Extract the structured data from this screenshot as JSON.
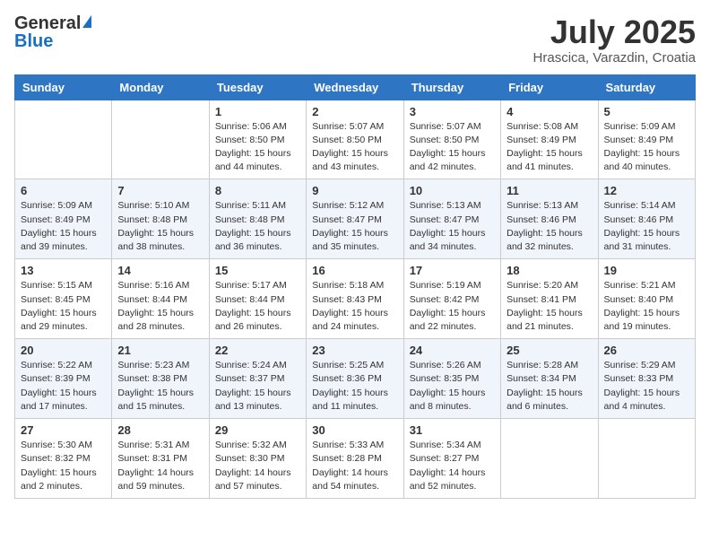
{
  "header": {
    "logo_general": "General",
    "logo_blue": "Blue",
    "month_year": "July 2025",
    "location": "Hrascica, Varazdin, Croatia"
  },
  "days_of_week": [
    "Sunday",
    "Monday",
    "Tuesday",
    "Wednesday",
    "Thursday",
    "Friday",
    "Saturday"
  ],
  "weeks": [
    [
      {
        "day": "",
        "info": ""
      },
      {
        "day": "",
        "info": ""
      },
      {
        "day": "1",
        "info": "Sunrise: 5:06 AM\nSunset: 8:50 PM\nDaylight: 15 hours\nand 44 minutes."
      },
      {
        "day": "2",
        "info": "Sunrise: 5:07 AM\nSunset: 8:50 PM\nDaylight: 15 hours\nand 43 minutes."
      },
      {
        "day": "3",
        "info": "Sunrise: 5:07 AM\nSunset: 8:50 PM\nDaylight: 15 hours\nand 42 minutes."
      },
      {
        "day": "4",
        "info": "Sunrise: 5:08 AM\nSunset: 8:49 PM\nDaylight: 15 hours\nand 41 minutes."
      },
      {
        "day": "5",
        "info": "Sunrise: 5:09 AM\nSunset: 8:49 PM\nDaylight: 15 hours\nand 40 minutes."
      }
    ],
    [
      {
        "day": "6",
        "info": "Sunrise: 5:09 AM\nSunset: 8:49 PM\nDaylight: 15 hours\nand 39 minutes."
      },
      {
        "day": "7",
        "info": "Sunrise: 5:10 AM\nSunset: 8:48 PM\nDaylight: 15 hours\nand 38 minutes."
      },
      {
        "day": "8",
        "info": "Sunrise: 5:11 AM\nSunset: 8:48 PM\nDaylight: 15 hours\nand 36 minutes."
      },
      {
        "day": "9",
        "info": "Sunrise: 5:12 AM\nSunset: 8:47 PM\nDaylight: 15 hours\nand 35 minutes."
      },
      {
        "day": "10",
        "info": "Sunrise: 5:13 AM\nSunset: 8:47 PM\nDaylight: 15 hours\nand 34 minutes."
      },
      {
        "day": "11",
        "info": "Sunrise: 5:13 AM\nSunset: 8:46 PM\nDaylight: 15 hours\nand 32 minutes."
      },
      {
        "day": "12",
        "info": "Sunrise: 5:14 AM\nSunset: 8:46 PM\nDaylight: 15 hours\nand 31 minutes."
      }
    ],
    [
      {
        "day": "13",
        "info": "Sunrise: 5:15 AM\nSunset: 8:45 PM\nDaylight: 15 hours\nand 29 minutes."
      },
      {
        "day": "14",
        "info": "Sunrise: 5:16 AM\nSunset: 8:44 PM\nDaylight: 15 hours\nand 28 minutes."
      },
      {
        "day": "15",
        "info": "Sunrise: 5:17 AM\nSunset: 8:44 PM\nDaylight: 15 hours\nand 26 minutes."
      },
      {
        "day": "16",
        "info": "Sunrise: 5:18 AM\nSunset: 8:43 PM\nDaylight: 15 hours\nand 24 minutes."
      },
      {
        "day": "17",
        "info": "Sunrise: 5:19 AM\nSunset: 8:42 PM\nDaylight: 15 hours\nand 22 minutes."
      },
      {
        "day": "18",
        "info": "Sunrise: 5:20 AM\nSunset: 8:41 PM\nDaylight: 15 hours\nand 21 minutes."
      },
      {
        "day": "19",
        "info": "Sunrise: 5:21 AM\nSunset: 8:40 PM\nDaylight: 15 hours\nand 19 minutes."
      }
    ],
    [
      {
        "day": "20",
        "info": "Sunrise: 5:22 AM\nSunset: 8:39 PM\nDaylight: 15 hours\nand 17 minutes."
      },
      {
        "day": "21",
        "info": "Sunrise: 5:23 AM\nSunset: 8:38 PM\nDaylight: 15 hours\nand 15 minutes."
      },
      {
        "day": "22",
        "info": "Sunrise: 5:24 AM\nSunset: 8:37 PM\nDaylight: 15 hours\nand 13 minutes."
      },
      {
        "day": "23",
        "info": "Sunrise: 5:25 AM\nSunset: 8:36 PM\nDaylight: 15 hours\nand 11 minutes."
      },
      {
        "day": "24",
        "info": "Sunrise: 5:26 AM\nSunset: 8:35 PM\nDaylight: 15 hours\nand 8 minutes."
      },
      {
        "day": "25",
        "info": "Sunrise: 5:28 AM\nSunset: 8:34 PM\nDaylight: 15 hours\nand 6 minutes."
      },
      {
        "day": "26",
        "info": "Sunrise: 5:29 AM\nSunset: 8:33 PM\nDaylight: 15 hours\nand 4 minutes."
      }
    ],
    [
      {
        "day": "27",
        "info": "Sunrise: 5:30 AM\nSunset: 8:32 PM\nDaylight: 15 hours\nand 2 minutes."
      },
      {
        "day": "28",
        "info": "Sunrise: 5:31 AM\nSunset: 8:31 PM\nDaylight: 14 hours\nand 59 minutes."
      },
      {
        "day": "29",
        "info": "Sunrise: 5:32 AM\nSunset: 8:30 PM\nDaylight: 14 hours\nand 57 minutes."
      },
      {
        "day": "30",
        "info": "Sunrise: 5:33 AM\nSunset: 8:28 PM\nDaylight: 14 hours\nand 54 minutes."
      },
      {
        "day": "31",
        "info": "Sunrise: 5:34 AM\nSunset: 8:27 PM\nDaylight: 14 hours\nand 52 minutes."
      },
      {
        "day": "",
        "info": ""
      },
      {
        "day": "",
        "info": ""
      }
    ]
  ]
}
